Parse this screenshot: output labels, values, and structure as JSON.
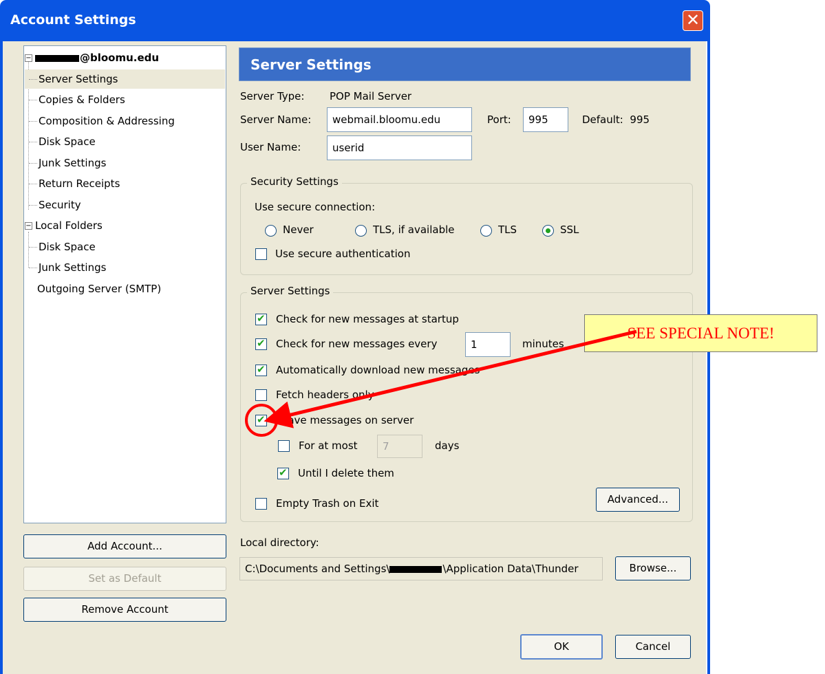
{
  "window": {
    "title": "Account Settings"
  },
  "tree": {
    "account_domain": "@bloomu.edu",
    "account_items": [
      "Server Settings",
      "Copies & Folders",
      "Composition & Addressing",
      "Disk Space",
      "Junk Settings",
      "Return Receipts",
      "Security"
    ],
    "local_folders": "Local Folders",
    "local_items": [
      "Disk Space",
      "Junk Settings"
    ],
    "outgoing": "Outgoing Server (SMTP)"
  },
  "left_buttons": {
    "add_account": "Add Account...",
    "set_default": "Set as Default",
    "remove_account": "Remove Account"
  },
  "panel": {
    "header": "Server Settings",
    "server_type_label": "Server Type:",
    "server_type_value": "POP Mail Server",
    "server_name_label": "Server Name:",
    "server_name_value": "webmail.bloomu.edu",
    "port_label": "Port:",
    "port_value": "995",
    "default_label": "Default:",
    "default_value": "995",
    "user_name_label": "User Name:",
    "user_name_value": "userid"
  },
  "security": {
    "title": "Security Settings",
    "use_secure_connection": "Use secure connection:",
    "options": [
      "Never",
      "TLS, if available",
      "TLS",
      "SSL"
    ],
    "selected": "SSL",
    "use_secure_auth": "Use secure authentication",
    "use_secure_auth_checked": false
  },
  "server_settings": {
    "title": "Server Settings",
    "check_startup": "Check for new messages at startup",
    "check_every": "Check for new messages every",
    "check_every_value": "1",
    "minutes": "minutes",
    "auto_download": "Automatically download new messages",
    "fetch_headers": "Fetch headers only",
    "leave_on_server": "Leave messages on server",
    "for_at_most": "For at most",
    "for_at_most_value": "7",
    "days": "days",
    "until_delete": "Until I delete them",
    "empty_trash": "Empty Trash on Exit",
    "advanced": "Advanced...",
    "checked": {
      "check_startup": true,
      "check_every": true,
      "auto_download": true,
      "fetch_headers": false,
      "leave_on_server": true,
      "for_at_most": false,
      "until_delete": true,
      "empty_trash": false
    }
  },
  "local_directory": {
    "label": "Local directory:",
    "path_prefix": "C:\\Documents and Settings\\",
    "path_suffix": "\\Application Data\\Thunder",
    "browse": "Browse..."
  },
  "dialog_buttons": {
    "ok": "OK",
    "cancel": "Cancel"
  },
  "annotation": {
    "text": "SEE SPECIAL NOTE!",
    "color": "#ff0000",
    "fill": "#ffffa0"
  }
}
